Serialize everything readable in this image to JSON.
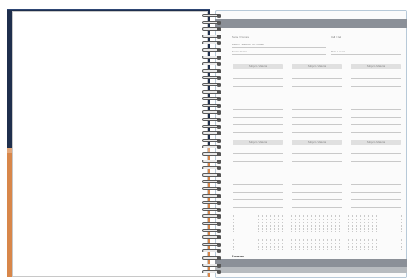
{
  "planner": {
    "fields": {
      "name_label": "Name / Nombre",
      "cell_label": "Cell / Cel",
      "phone_label": "Phone / Teléfono / Tel. Celular",
      "email_label": "Email / Correo",
      "date_label": "Date / Fecha"
    },
    "sections_top": [
      {
        "label": "Subject / Materia"
      },
      {
        "label": "Subject / Materia"
      },
      {
        "label": "Subject / Materia"
      }
    ],
    "sections_bottom": [
      {
        "label": "Subject / Materia"
      },
      {
        "label": "Subject / Materia"
      },
      {
        "label": "Subject / Materia"
      }
    ],
    "footer": "Passwo"
  }
}
